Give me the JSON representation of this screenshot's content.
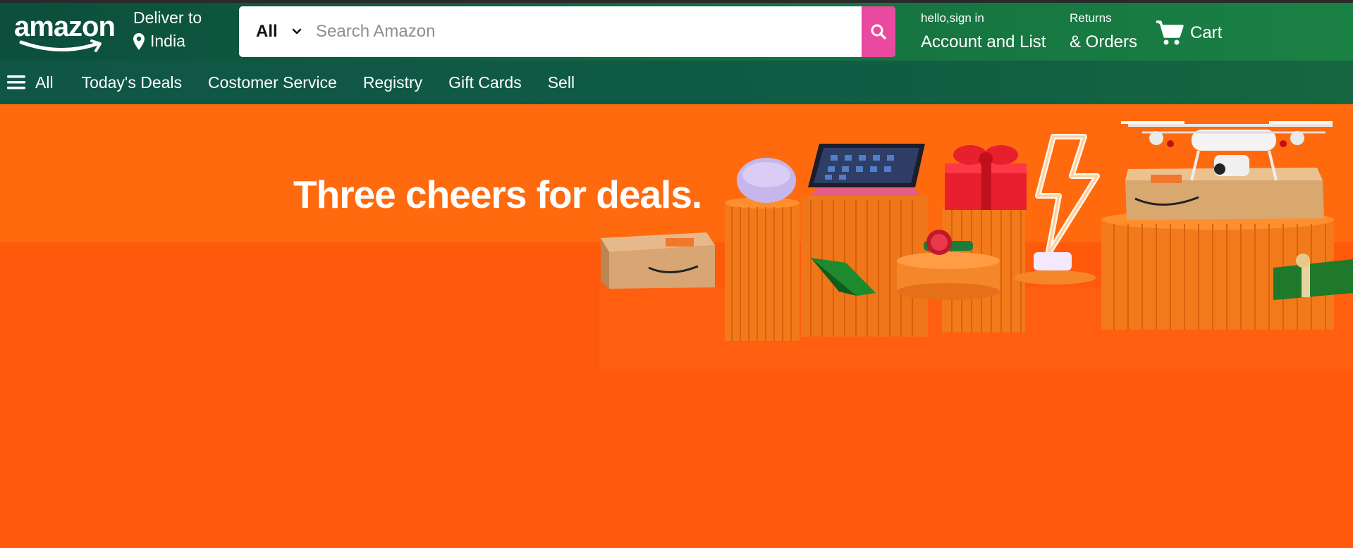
{
  "header": {
    "logo_text": "amazon",
    "deliver_label": "Deliver to",
    "deliver_location": "India",
    "search": {
      "category": "All",
      "placeholder": "Search Amazon",
      "value": ""
    },
    "account_greeting": "hello,sign in",
    "account_label": "Account and List",
    "returns_label": "Returns",
    "orders_label": "& Orders",
    "cart_label": "Cart"
  },
  "nav": {
    "all_label": "All",
    "items": [
      {
        "label": "Today's Deals"
      },
      {
        "label": "Costomer Service"
      },
      {
        "label": "Registry"
      },
      {
        "label": "Gift Cards"
      },
      {
        "label": "Sell"
      }
    ]
  },
  "hero": {
    "headline": "Three cheers for deals."
  },
  "colors": {
    "header_green": "#0e5a3f",
    "nav_green": "#105646",
    "search_button": "#e94aa0",
    "hero_orange": "#ff590b"
  },
  "icons": [
    "smile-arrow-icon",
    "location-pin-icon",
    "chevron-down-icon",
    "search-icon",
    "cart-icon",
    "hamburger-icon"
  ]
}
